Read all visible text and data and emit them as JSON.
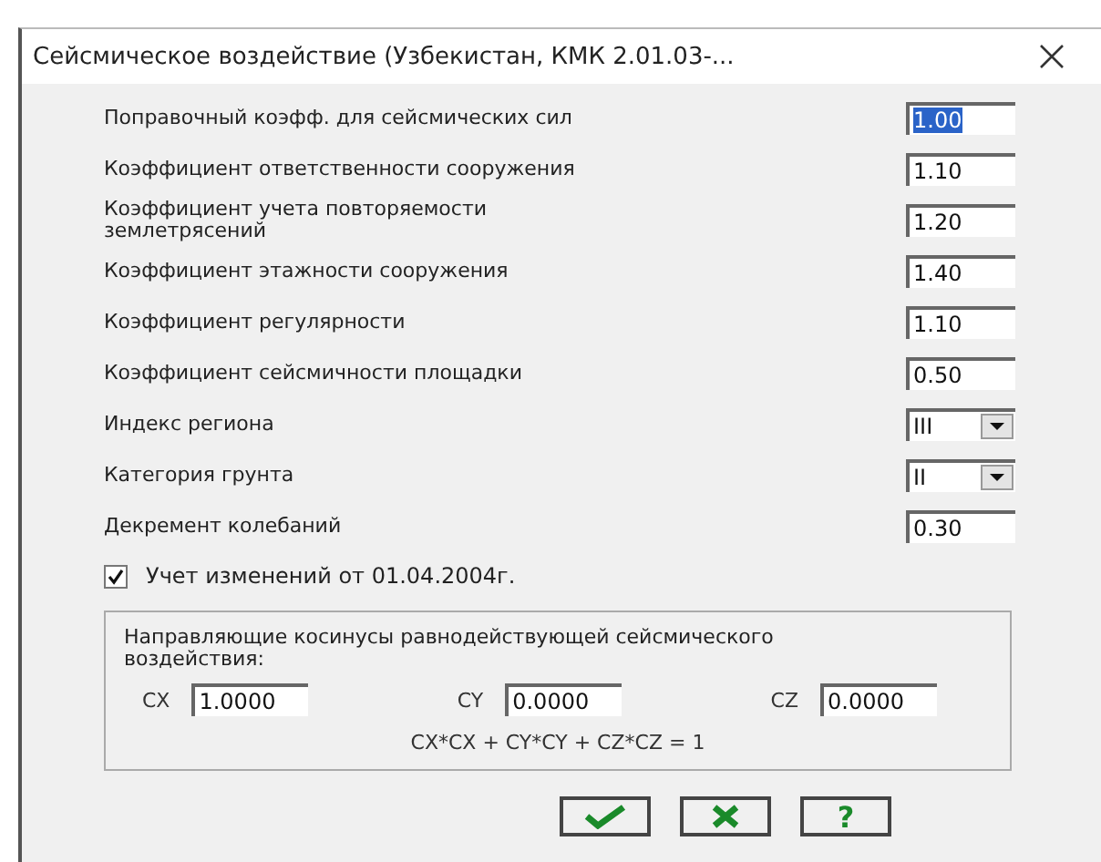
{
  "window": {
    "title": "Сейсмическое воздействие (Узбекистан, КМК 2.01.03-..."
  },
  "params": [
    {
      "label": "Поправочный коэфф. для сейсмических сил",
      "kind": "input",
      "value": "1.00",
      "selected": true
    },
    {
      "label": "Коэффициент ответственности сооружения",
      "kind": "input",
      "value": "1.10",
      "selected": false
    },
    {
      "label": "Коэффициент учета повторяемости землетрясений",
      "kind": "input",
      "value": "1.20",
      "selected": false
    },
    {
      "label": "Коэффициент этажности сооружения",
      "kind": "input",
      "value": "1.40",
      "selected": false
    },
    {
      "label": "Коэффициент регулярности",
      "kind": "input",
      "value": "1.10",
      "selected": false
    },
    {
      "label": "Коэффициент сейсмичности площадки",
      "kind": "input",
      "value": "0.50",
      "selected": false
    },
    {
      "label": "Индекс региона",
      "kind": "select",
      "value": "III",
      "selected": false
    },
    {
      "label": "Категория грунта",
      "kind": "select",
      "value": "II",
      "selected": false
    },
    {
      "label": "Декремент колебаний",
      "kind": "input",
      "value": "0.30",
      "selected": false
    }
  ],
  "option": {
    "label": "Учет изменений от 01.04.2004г.",
    "checked": true
  },
  "cosines": {
    "title": "Направляющие косинусы равнодействующей сейсмического воздействия:",
    "fields": [
      {
        "label": "CX",
        "value": "1.0000"
      },
      {
        "label": "CY",
        "value": "0.0000"
      },
      {
        "label": "CZ",
        "value": "0.0000"
      }
    ],
    "formula": "CX*CX + CY*CY + CZ*CZ = 1"
  },
  "buttons": [
    {
      "kind": "ok"
    },
    {
      "kind": "cancel"
    },
    {
      "kind": "help",
      "text": "?"
    }
  ]
}
